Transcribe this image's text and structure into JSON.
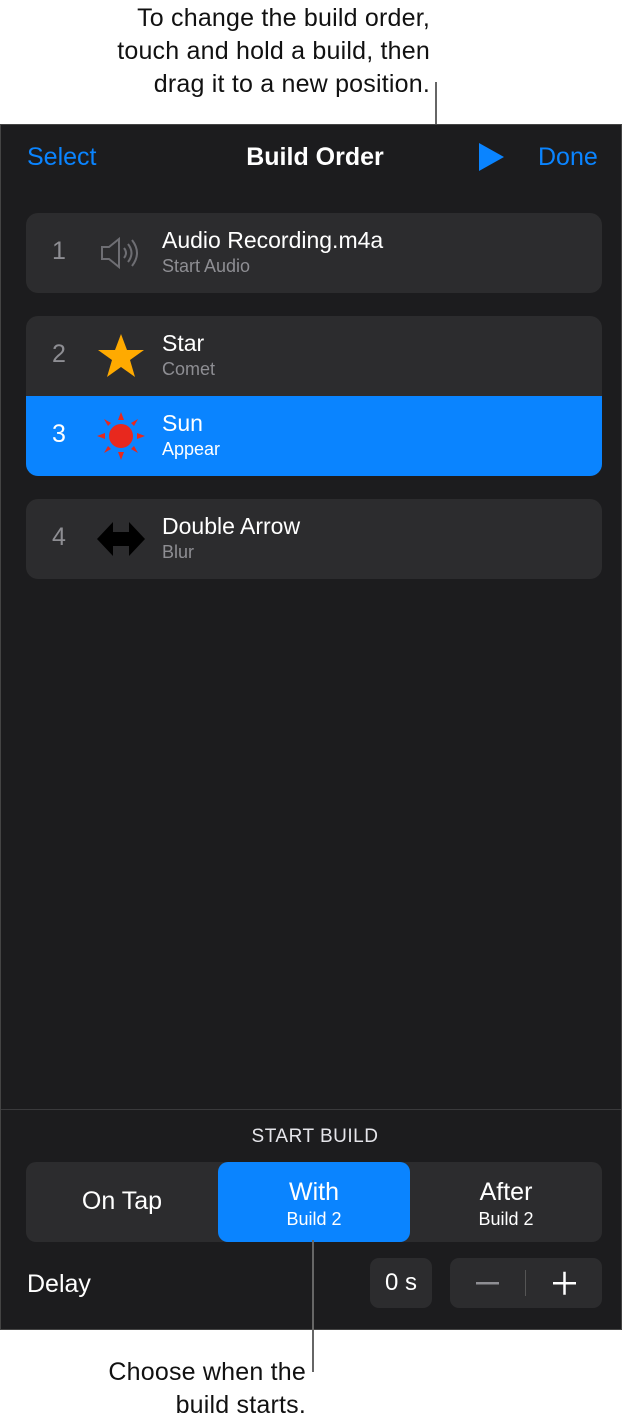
{
  "callouts": {
    "top": [
      "To change the build order,",
      "touch and hold a build, then",
      "drag it to a new position."
    ],
    "bottom": [
      "Choose when the",
      "build starts."
    ]
  },
  "navbar": {
    "select_label": "Select",
    "title": "Build Order",
    "play_icon": "play-icon",
    "done_label": "Done"
  },
  "builds": [
    {
      "number": "1",
      "title": "Audio Recording.m4a",
      "subtitle": "Start Audio",
      "icon": "speaker-icon"
    },
    {
      "number": "2",
      "title": "Star",
      "subtitle": "Comet",
      "icon": "star-icon"
    },
    {
      "number": "3",
      "title": "Sun",
      "subtitle": "Appear",
      "icon": "sun-icon",
      "selected": true
    },
    {
      "number": "4",
      "title": "Double Arrow",
      "subtitle": "Blur",
      "icon": "double-arrow-icon"
    }
  ],
  "start_build": {
    "label": "START BUILD",
    "options": [
      {
        "label": "On Tap",
        "sub": ""
      },
      {
        "label": "With",
        "sub": "Build 2",
        "selected": true
      },
      {
        "label": "After",
        "sub": "Build 2"
      }
    ]
  },
  "delay": {
    "label": "Delay",
    "value": "0 s"
  },
  "colors": {
    "accent": "#0a84ff",
    "panel": "#1c1c1e",
    "row": "#2c2c2e",
    "star": "#ffaa00",
    "sun": "#e8281e"
  }
}
